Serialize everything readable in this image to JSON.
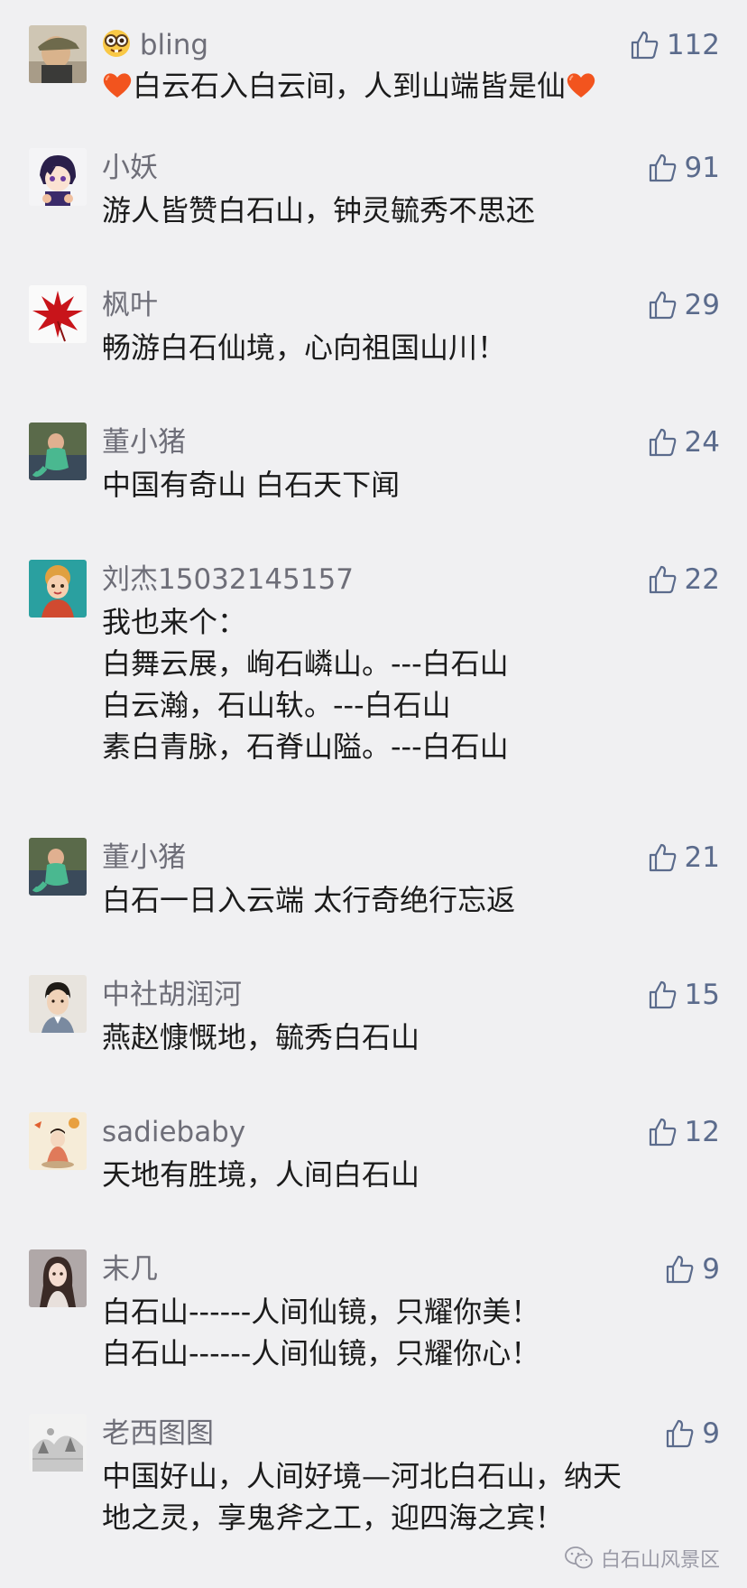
{
  "comments": [
    {
      "name": "bling",
      "lines": [
        "白云石入白云间，人到山端皆是仙"
      ],
      "likes": "112",
      "avatar": "avatar-photo-person-cap",
      "name_prefix_icon": "nerd-face-emoji",
      "text_decoration_icon": "red-heart-emoji"
    },
    {
      "name": "小妖",
      "lines": [
        "游人皆赞白石山，钟灵毓秀不思还"
      ],
      "likes": "91",
      "avatar": "avatar-anime-character"
    },
    {
      "name": "枫叶",
      "lines": [
        "畅游白石仙境，心向祖国山川！"
      ],
      "likes": "29",
      "avatar": "avatar-red-maple-leaf"
    },
    {
      "name": "董小猪",
      "lines": [
        "中国有奇山 白石天下闻"
      ],
      "likes": "24",
      "avatar": "avatar-photo-mermaid-child"
    },
    {
      "name": "刘杰15032145157",
      "lines": [
        "我也来个：",
        "白舞云展，峋石嶙山。---白石山",
        "白云瀚，石山轪。---白石山",
        "素白青脉，石脊山隘。---白石山"
      ],
      "likes": "22",
      "avatar": "avatar-photo-costume-woman"
    },
    {
      "name": "董小猪",
      "lines": [
        "白石一日入云端 太行奇绝行忘返"
      ],
      "likes": "21",
      "avatar": "avatar-photo-mermaid-child"
    },
    {
      "name": "中社胡润河",
      "lines": [
        "燕赵慷慨地，毓秀白石山"
      ],
      "likes": "15",
      "avatar": "avatar-photo-man-portrait"
    },
    {
      "name": "sadiebaby",
      "lines": [
        "天地有胜境，人间白石山"
      ],
      "likes": "12",
      "avatar": "avatar-illustration-girl"
    },
    {
      "name": "末几",
      "lines": [
        "白石山------人间仙镜，只耀你美！",
        "白石山------人间仙镜，只耀你心！"
      ],
      "likes": "9",
      "avatar": "avatar-photo-doll"
    },
    {
      "name": "老西图图",
      "lines": [
        "中国好山，人间好境—河北白石山，纳天",
        "地之灵，享鬼斧之工，迎四海之宾！"
      ],
      "likes": "9",
      "avatar": "avatar-sketch-landscape"
    }
  ],
  "footer": {
    "brand": "白石山风景区",
    "icon": "wechat-icon"
  },
  "colors": {
    "background": "#f0f0f2",
    "name": "#6e6e78",
    "text": "#1b1b1b",
    "like": "#5b6b8c"
  }
}
